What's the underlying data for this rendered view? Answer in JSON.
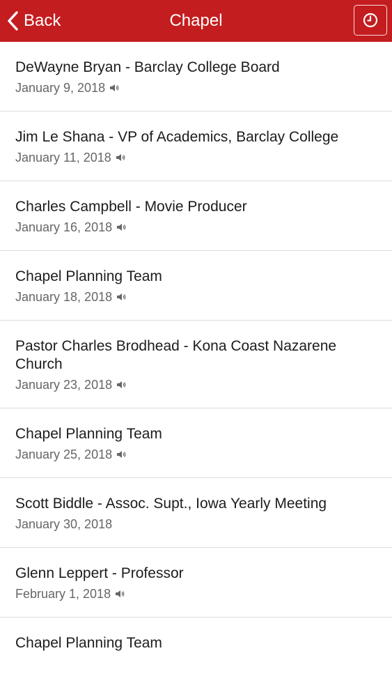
{
  "navbar": {
    "back_label": "Back",
    "title": "Chapel",
    "back_icon": "chevron-left-icon",
    "history_icon": "clock-icon",
    "bg_color": "#c41d1f"
  },
  "items": [
    {
      "title": "DeWayne Bryan - Barclay College Board",
      "date": "January 9, 2018",
      "audio": true
    },
    {
      "title": "Jim Le Shana - VP of Academics, Barclay College",
      "date": "January 11, 2018",
      "audio": true
    },
    {
      "title": "Charles Campbell - Movie Producer",
      "date": "January 16, 2018",
      "audio": true
    },
    {
      "title": "Chapel Planning Team",
      "date": "January 18, 2018",
      "audio": true
    },
    {
      "title": "Pastor Charles Brodhead - Kona Coast Nazarene Church",
      "date": "January 23, 2018",
      "audio": true
    },
    {
      "title": "Chapel Planning Team",
      "date": "January 25, 2018",
      "audio": true
    },
    {
      "title": "Scott Biddle - Assoc. Supt., Iowa Yearly Meeting",
      "date": "January 30, 2018",
      "audio": false
    },
    {
      "title": "Glenn Leppert - Professor",
      "date": "February 1, 2018",
      "audio": true
    },
    {
      "title": "Chapel Planning Team",
      "date": "",
      "audio": false
    }
  ]
}
